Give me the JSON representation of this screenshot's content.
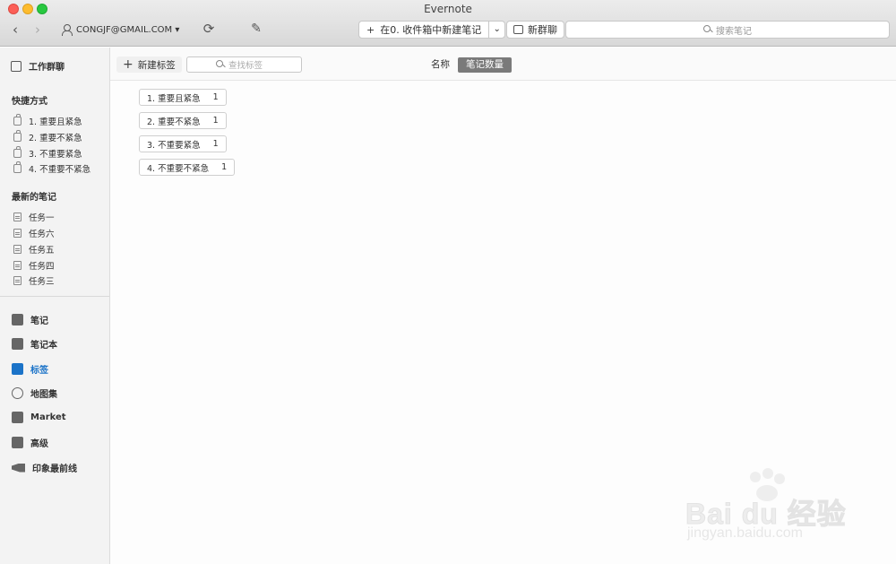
{
  "window": {
    "title": "Evernote"
  },
  "toolbar": {
    "account": "CONGJF@GMAIL.COM ▾",
    "new_note_label": "在0. 收件箱中新建笔记",
    "new_note_dropdown": "⌄",
    "new_chat_label": "新群聊",
    "search_placeholder": "搜索笔记"
  },
  "sidebar": {
    "work_chat": "工作群聊",
    "shortcuts_title": "快捷方式",
    "shortcuts": [
      "1. 重要且紧急",
      "2. 重要不紧急",
      "3. 不重要紧急",
      "4. 不重要不紧急"
    ],
    "recent_title": "最新的笔记",
    "recent": [
      "任务一",
      "任务六",
      "任务五",
      "任务四",
      "任务三"
    ],
    "main_items": [
      {
        "label": "笔记",
        "icon": "note-icon"
      },
      {
        "label": "笔记本",
        "icon": "notebook-icon"
      },
      {
        "label": "标签",
        "icon": "tag-icon",
        "active": true
      },
      {
        "label": "地图集",
        "icon": "atlas-icon"
      },
      {
        "label": "Market",
        "icon": "market-icon"
      },
      {
        "label": "高级",
        "icon": "premium-icon"
      },
      {
        "label": "印象最前线",
        "icon": "horn-icon"
      }
    ],
    "active_color": "#1b73c8"
  },
  "main": {
    "new_tag_label": "新建标签",
    "tag_search_placeholder": "查找标签",
    "sort_options": [
      "名称",
      "笔记数量"
    ],
    "sort_active": "笔记数量",
    "tags": [
      {
        "name": "1. 重要且紧急",
        "count": "1"
      },
      {
        "name": "2. 重要不紧急",
        "count": "1"
      },
      {
        "name": "3. 不重要紧急",
        "count": "1"
      },
      {
        "name": "4. 不重要不紧急",
        "count": "1"
      }
    ]
  },
  "watermark": {
    "brand": "Bai du 经验",
    "url": "jingyan.baidu.com"
  }
}
